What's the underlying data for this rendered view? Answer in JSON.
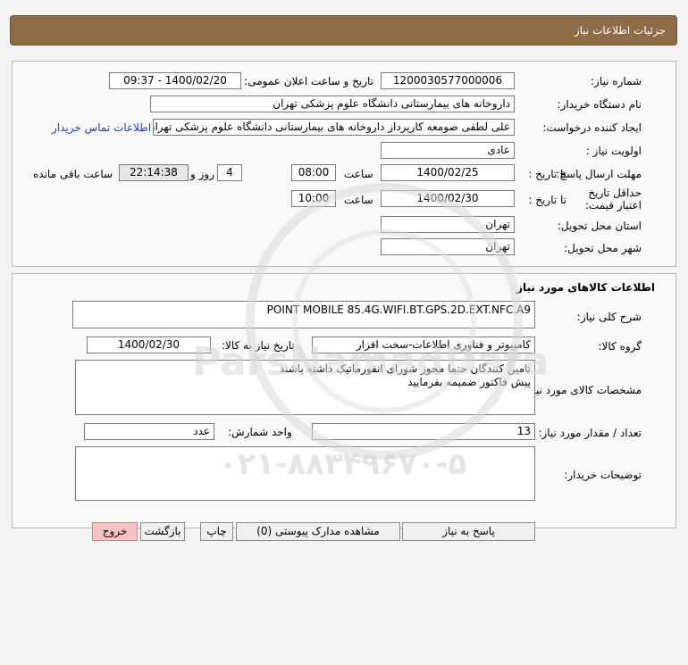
{
  "page_title": "جزئیات اطلاعات نیاز",
  "need_number": {
    "label": "شماره نیاز:",
    "value": "1200030577000006"
  },
  "announce": {
    "label": "تاریخ و ساعت اعلان عمومی:",
    "value": "1400/02/20 - 09:37"
  },
  "buyer_org": {
    "label": "نام دستگاه خریدار:",
    "value": "داروخانه های بیمارستانی دانشگاه علوم پزشکی تهران"
  },
  "requester": {
    "label": "ایجاد کننده درخواست:",
    "value": "علی لطفی صومعه کارپرداز داروخانه های بیمارستانی دانشگاه علوم پزشکی تهران",
    "contact_link": "اطلاعات تماس خریدار"
  },
  "priority": {
    "label": "اولویت نیاز :",
    "value": "عادی"
  },
  "deadline": {
    "label": "مهلت ارسال پاسخ:",
    "to_date_label": "تا تاریخ :",
    "date": "1400/02/25",
    "time_label": "ساعت",
    "time": "08:00",
    "days": "4",
    "days_label": "روز و",
    "remaining": "22:14:38",
    "remaining_label": "ساعت باقی مانده"
  },
  "validity": {
    "label": "حداقل تاریخ اعتبار قیمت:",
    "to_date_label": "تا تاریخ :",
    "date": "1400/02/30",
    "time_label": "ساعت",
    "time": "10:00"
  },
  "province": {
    "label": "استان محل تحویل:",
    "value": "تهران"
  },
  "city": {
    "label": "شهر محل تحویل:",
    "value": "تهران"
  },
  "goods_section_title": "اطلاعات کالاهای مورد نیاز",
  "general_desc": {
    "label": "شرح کلی نیاز:",
    "value": "POINT MOBILE 85.4G.WIFI.BT.GPS.2D.EXT.NFC.A9"
  },
  "goods_group": {
    "label": "گروه کالا:",
    "value": "کامپیوتر و فناوری اطلاعات-سخت افزار",
    "need_date_label": "تاریخ نیاز به کالا:",
    "need_date": "1400/02/30"
  },
  "specs": {
    "label": "مشخصات کالای مورد نیاز:",
    "line1": "تامین کنندگان حتما مجوز شورای انفورماتیک داشته باشند",
    "line2": "پیش فاکتور ضمیمه بفرمایید"
  },
  "quantity": {
    "label": "تعداد / مقدار مورد نیاز:",
    "value": "13",
    "unit_label": "واحد شمارش:",
    "unit": "عدد"
  },
  "buyer_notes": {
    "label": "توضیحات خریدار:",
    "value": ""
  },
  "buttons": {
    "respond": "پاسخ به نیاز",
    "view_docs": "مشاهده مدارک پیوستی (0)",
    "print": "چاپ",
    "back": "بازگشت",
    "exit": "خروج"
  },
  "watermark": {
    "brand": "ParsNamadData",
    "phone": "۰۲۱-۸۸۳۴۹۶۷۰-۵"
  }
}
